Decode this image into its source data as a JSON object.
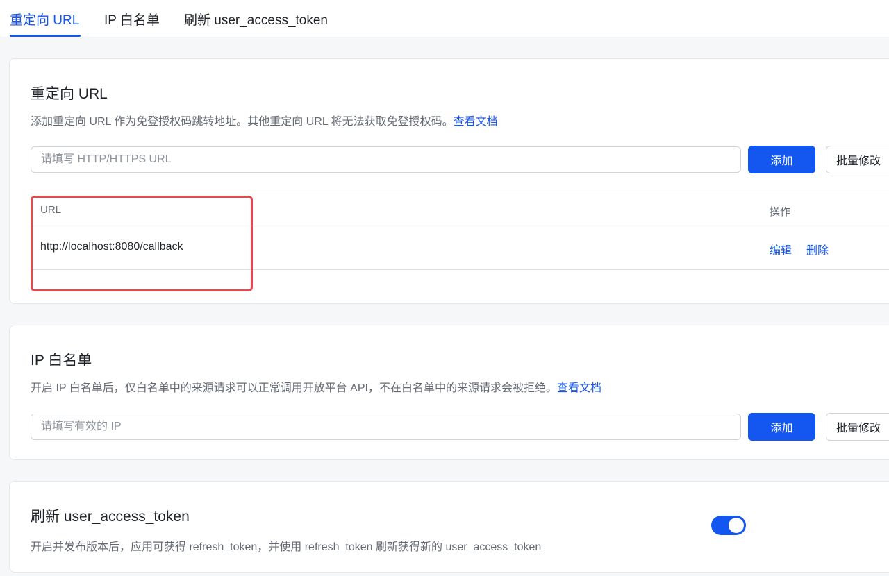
{
  "tabs": [
    {
      "label": "重定向 URL",
      "active": true
    },
    {
      "label": "IP 白名单",
      "active": false
    },
    {
      "label": "刷新 user_access_token",
      "active": false
    }
  ],
  "redirect": {
    "title": "重定向 URL",
    "desc": "添加重定向 URL 作为免登授权码跳转地址。其他重定向 URL 将无法获取免登授权码。",
    "doc_link": "查看文档",
    "input_placeholder": "请填写 HTTP/HTTPS URL",
    "add_label": "添加",
    "batch_label": "批量修改",
    "table": {
      "col_url": "URL",
      "col_ops": "操作",
      "rows": [
        {
          "url": "http://localhost:8080/callback",
          "edit": "编辑",
          "delete": "删除"
        }
      ]
    }
  },
  "ip_whitelist": {
    "title": "IP 白名单",
    "desc": "开启 IP 白名单后，仅白名单中的来源请求可以正常调用开放平台 API，不在白名单中的来源请求会被拒绝。",
    "doc_link": "查看文档",
    "input_placeholder": "请填写有效的 IP",
    "add_label": "添加",
    "batch_label": "批量修改"
  },
  "refresh": {
    "title": "刷新 user_access_token",
    "desc": "开启并发布版本后，应用可获得 refresh_token，并使用 refresh_token 刷新获得新的 user_access_token",
    "enabled": true
  },
  "colors": {
    "accent": "#1456f0",
    "highlight": "#e5484d",
    "text": "#1f2329",
    "subtext": "#646a73"
  }
}
